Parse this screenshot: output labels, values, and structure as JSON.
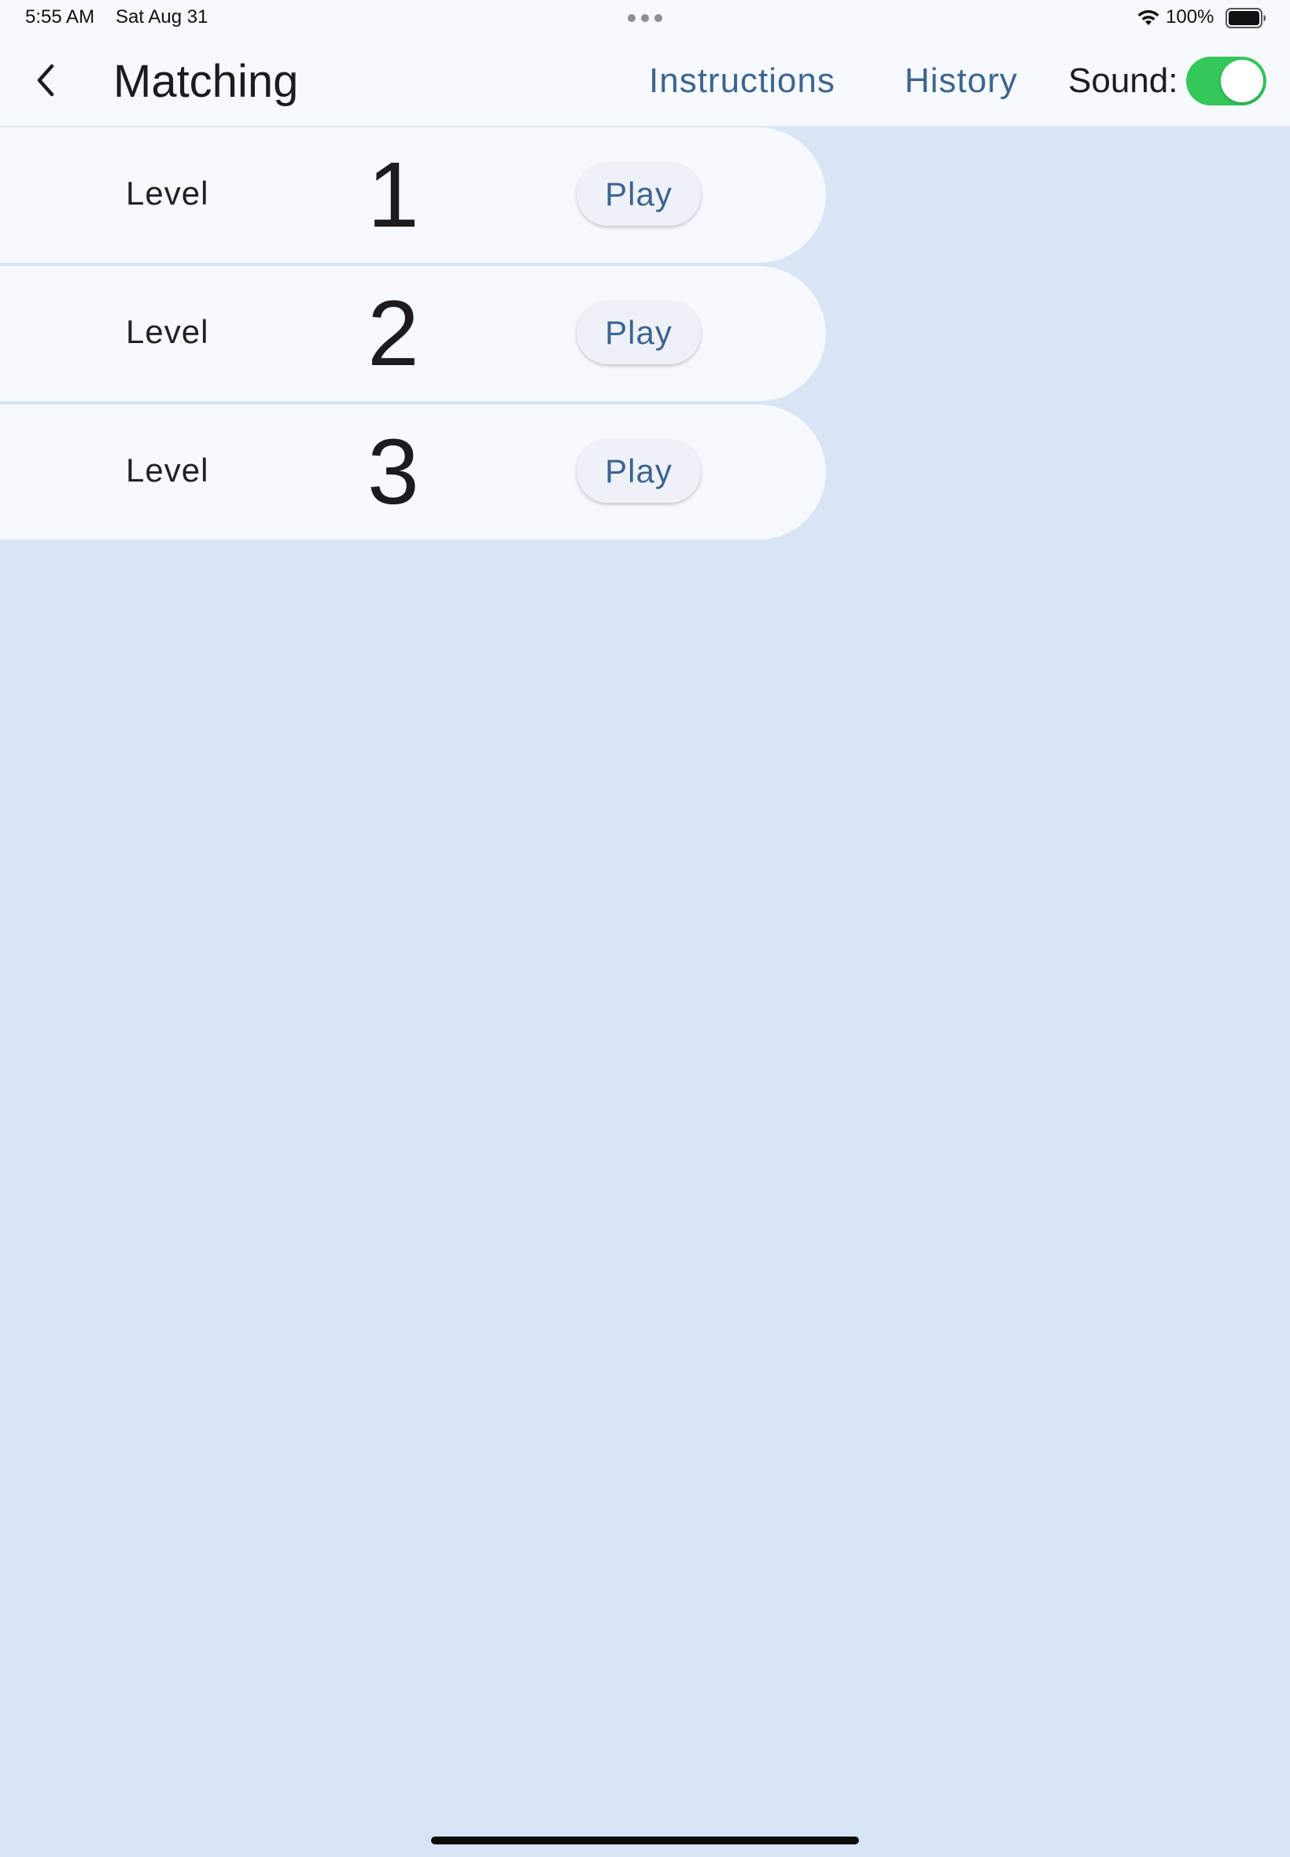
{
  "status_bar": {
    "time": "5:55 AM",
    "date": "Sat Aug 31",
    "battery": "100%"
  },
  "nav": {
    "title": "Matching",
    "instructions_label": "Instructions",
    "history_label": "History",
    "sound_label": "Sound:",
    "sound_on": true
  },
  "levels": [
    {
      "label": "Level",
      "number": "1",
      "play_label": "Play"
    },
    {
      "label": "Level",
      "number": "2",
      "play_label": "Play"
    },
    {
      "label": "Level",
      "number": "3",
      "play_label": "Play"
    }
  ],
  "icons": {
    "back": "chevron-left-icon",
    "wifi": "wifi-icon",
    "battery": "battery-full-icon",
    "multitask": "multitask-dots-icon"
  },
  "colors": {
    "background": "#d8e5f5",
    "card": "#f6f9fd",
    "link": "#3d6590",
    "toggle_on": "#34c759"
  }
}
